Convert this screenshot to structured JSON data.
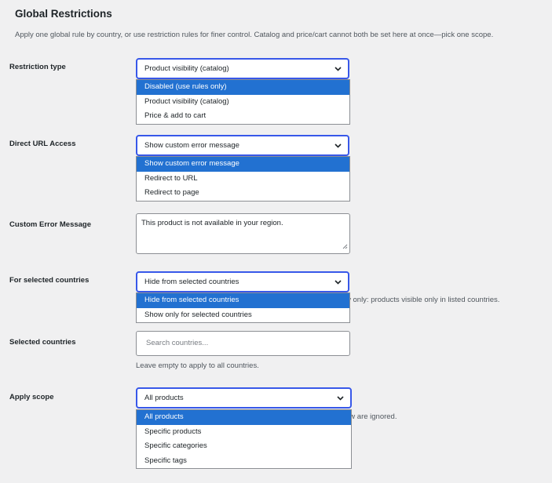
{
  "section": {
    "title": "Global Restrictions",
    "description": "Apply one global rule by country, or use restriction rules for finer control. Catalog and price/cart cannot both be set here at once—pick one scope."
  },
  "restriction_type": {
    "label": "Restriction type",
    "selected": "Product visibility (catalog)",
    "options": [
      "Disabled (use rules only)",
      "Product visibility (catalog)",
      "Price & add to cart"
    ]
  },
  "direct_url_access": {
    "label": "Direct URL Access",
    "selected": "Show custom error message",
    "options": [
      "Show custom error message",
      "Redirect to URL",
      "Redirect to page"
    ]
  },
  "custom_error": {
    "label": "Custom Error Message",
    "value": "This product is not available in your region."
  },
  "selected_countries_mode": {
    "label": "For selected countries",
    "selected": "Hide from selected countries",
    "options": [
      "Hide from selected countries",
      "Show only for selected countries"
    ],
    "help_partial": "w only: products visible only in listed countries."
  },
  "selected_countries": {
    "label": "Selected countries",
    "placeholder": "Search countries...",
    "help": "Leave empty to apply to all countries."
  },
  "apply_scope": {
    "label": "Apply scope",
    "selected": "All products",
    "options": [
      "All products",
      "Specific products",
      "Specific categories",
      "Specific tags"
    ],
    "help_partial": "ow are ignored."
  },
  "colors": {
    "accent": "#3858e9",
    "highlight": "#2271d1",
    "background": "#f0f0f1"
  },
  "icons": {
    "select_arrow": "chevron-down-icon",
    "textarea_resize": "resize-grip-icon"
  }
}
